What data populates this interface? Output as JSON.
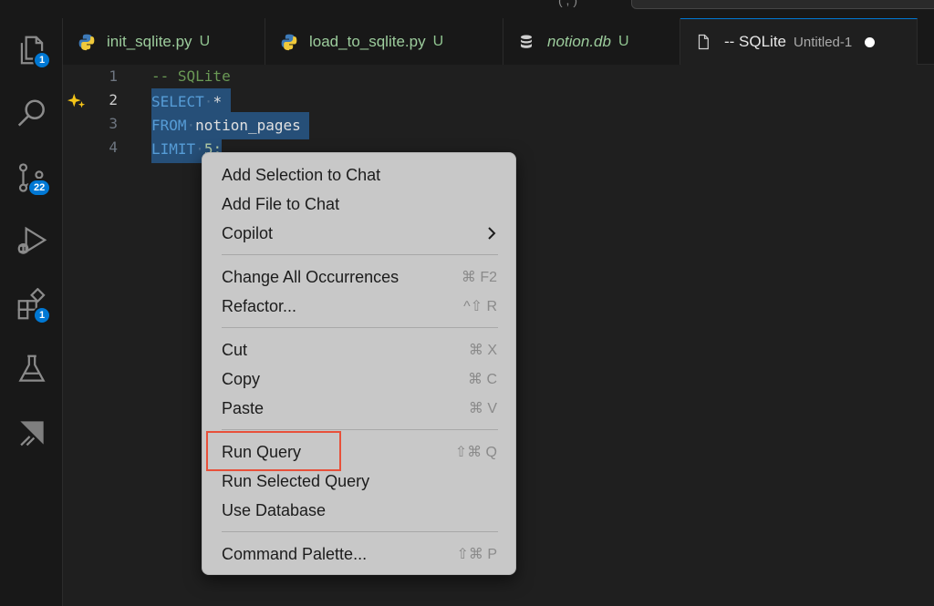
{
  "topbar": {
    "paren_text": "( , )"
  },
  "activity_bar": {
    "explorer_badge": "1",
    "source_control_badge": "22",
    "extensions_badge": "1"
  },
  "tabs": [
    {
      "label": "init_sqlite.py",
      "status": "U",
      "icon": "python-icon"
    },
    {
      "label": "load_to_sqlite.py",
      "status": "U",
      "icon": "python-icon"
    },
    {
      "label": "notion.db",
      "status": "U",
      "icon": "database-icon"
    },
    {
      "label": "-- SQLite",
      "description": "Untitled-1",
      "icon": "file-icon",
      "dirty": true
    }
  ],
  "editor": {
    "lines": [
      {
        "number": "1",
        "comment": "-- SQLite"
      },
      {
        "number": "2",
        "keyword": "SELECT",
        "rest": "*"
      },
      {
        "number": "3",
        "keyword": "FROM",
        "rest": "notion_pages"
      },
      {
        "number": "4",
        "keyword": "LIMIT",
        "rest": "5;"
      }
    ]
  },
  "context_menu": {
    "add_selection": "Add Selection to Chat",
    "add_file": "Add File to Chat",
    "copilot": "Copilot",
    "change_all": "Change All Occurrences",
    "change_all_kbd": "⌘ F2",
    "refactor": "Refactor...",
    "refactor_kbd": "^⇧ R",
    "cut": "Cut",
    "cut_kbd": "⌘ X",
    "copy": "Copy",
    "copy_kbd": "⌘ C",
    "paste": "Paste",
    "paste_kbd": "⌘ V",
    "run_query": "Run Query",
    "run_query_kbd": "⇧⌘ Q",
    "run_selected": "Run Selected Query",
    "use_database": "Use Database",
    "command_palette": "Command Palette...",
    "command_palette_kbd": "⇧⌘ P"
  },
  "colors": {
    "accent": "#0078d4",
    "highlight_box": "#e8503a",
    "selection": "#264f78"
  }
}
